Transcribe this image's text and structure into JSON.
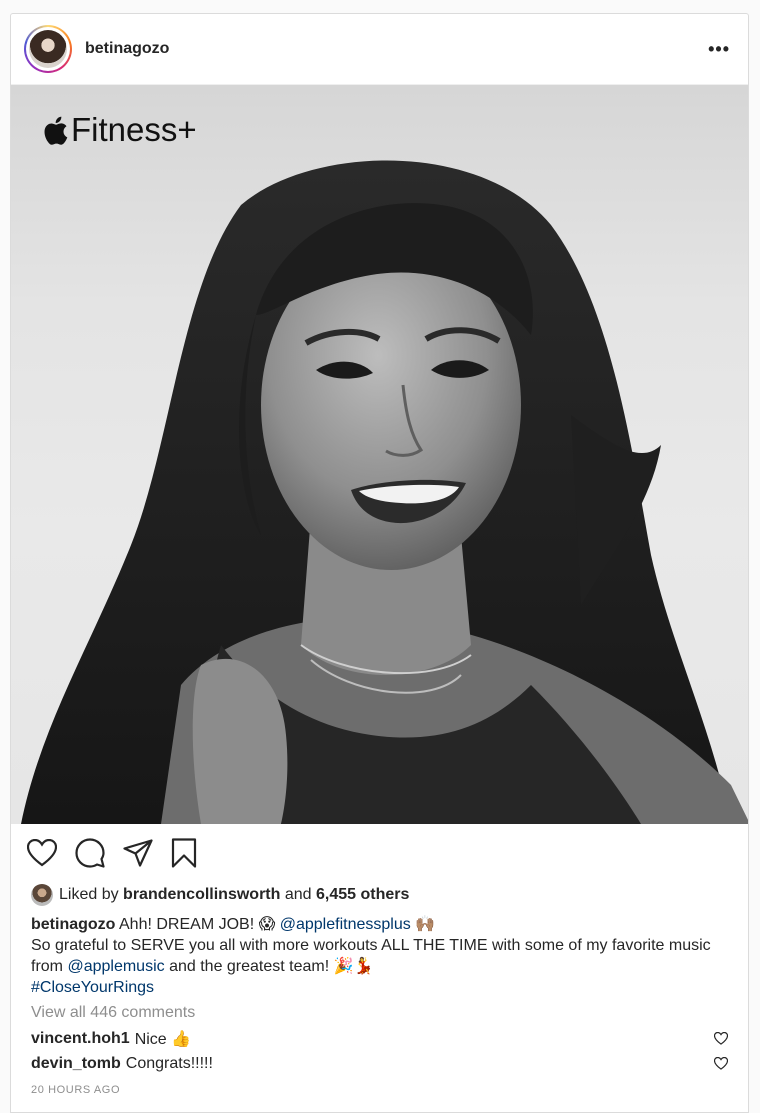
{
  "post": {
    "username": "betinagozo",
    "brand_text": "Fitness+",
    "likes": {
      "prefix": "Liked by",
      "liker": "brandencollinsworth",
      "and_text": "and",
      "others": "6,455 others"
    },
    "caption": {
      "username": "betinagozo",
      "line1_text": "Ahh! DREAM JOB! 😱",
      "mention1": "@applefitnessplus",
      "line1_tail": "🙌🏽",
      "line2": "So grateful to SERVE you all with more workouts ALL THE TIME with some of my favorite music from",
      "mention2": "@applemusic",
      "line2_tail": "and the greatest team! 🎉💃",
      "hashtag": "#CloseYourRings"
    },
    "view_all_comments": "View all 446 comments",
    "comments": [
      {
        "user": "vincent.hoh1",
        "text": "Nice 👍"
      },
      {
        "user": "devin_tomb",
        "text": "Congrats!!!!!"
      }
    ],
    "timestamp": "20 HOURS AGO"
  },
  "icons": {
    "more": "more-options-icon",
    "like": "heart-icon",
    "comment": "comment-icon",
    "share": "share-icon",
    "save": "bookmark-icon"
  },
  "colors": {
    "link": "#00376b",
    "muted": "#8e8e8e",
    "text": "#262626"
  }
}
